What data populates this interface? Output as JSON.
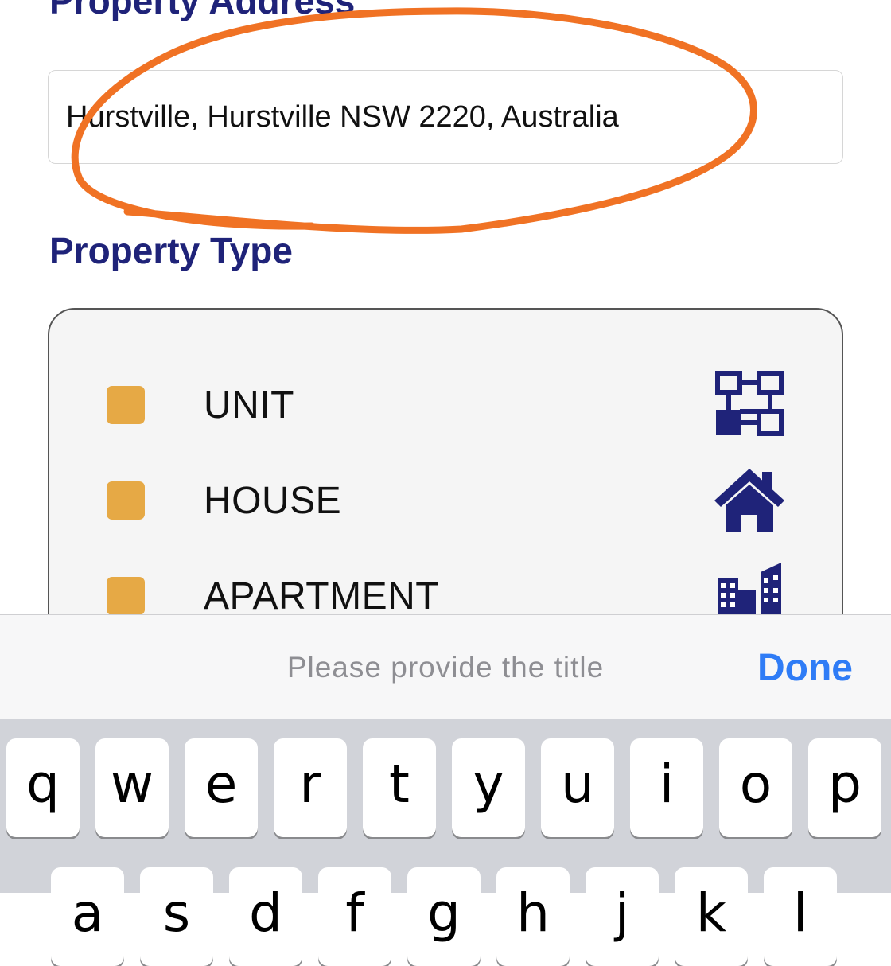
{
  "form": {
    "address_heading": "Property Address",
    "address_value": "Hurstville, Hurstville NSW 2220, Australia",
    "type_heading": "Property Type"
  },
  "property_types": [
    {
      "label": "UNIT",
      "icon": "floor-plan-icon",
      "checked": false
    },
    {
      "label": "HOUSE",
      "icon": "house-icon",
      "checked": false
    },
    {
      "label": "APARTMENT",
      "icon": "apartment-buildings-icon",
      "checked": false
    }
  ],
  "accessory_bar": {
    "title": "Please provide the title",
    "done_label": "Done"
  },
  "keyboard": {
    "row1": [
      "q",
      "w",
      "e",
      "r",
      "t",
      "y",
      "u",
      "i",
      "o",
      "p"
    ],
    "row2": [
      "a",
      "s",
      "d",
      "f",
      "g",
      "h",
      "j",
      "k",
      "l"
    ]
  },
  "colors": {
    "heading": "#1f2379",
    "checkbox": "#e6a945",
    "icon": "#1f2379",
    "annotation": "#f07224",
    "done": "#2f7cf6"
  }
}
